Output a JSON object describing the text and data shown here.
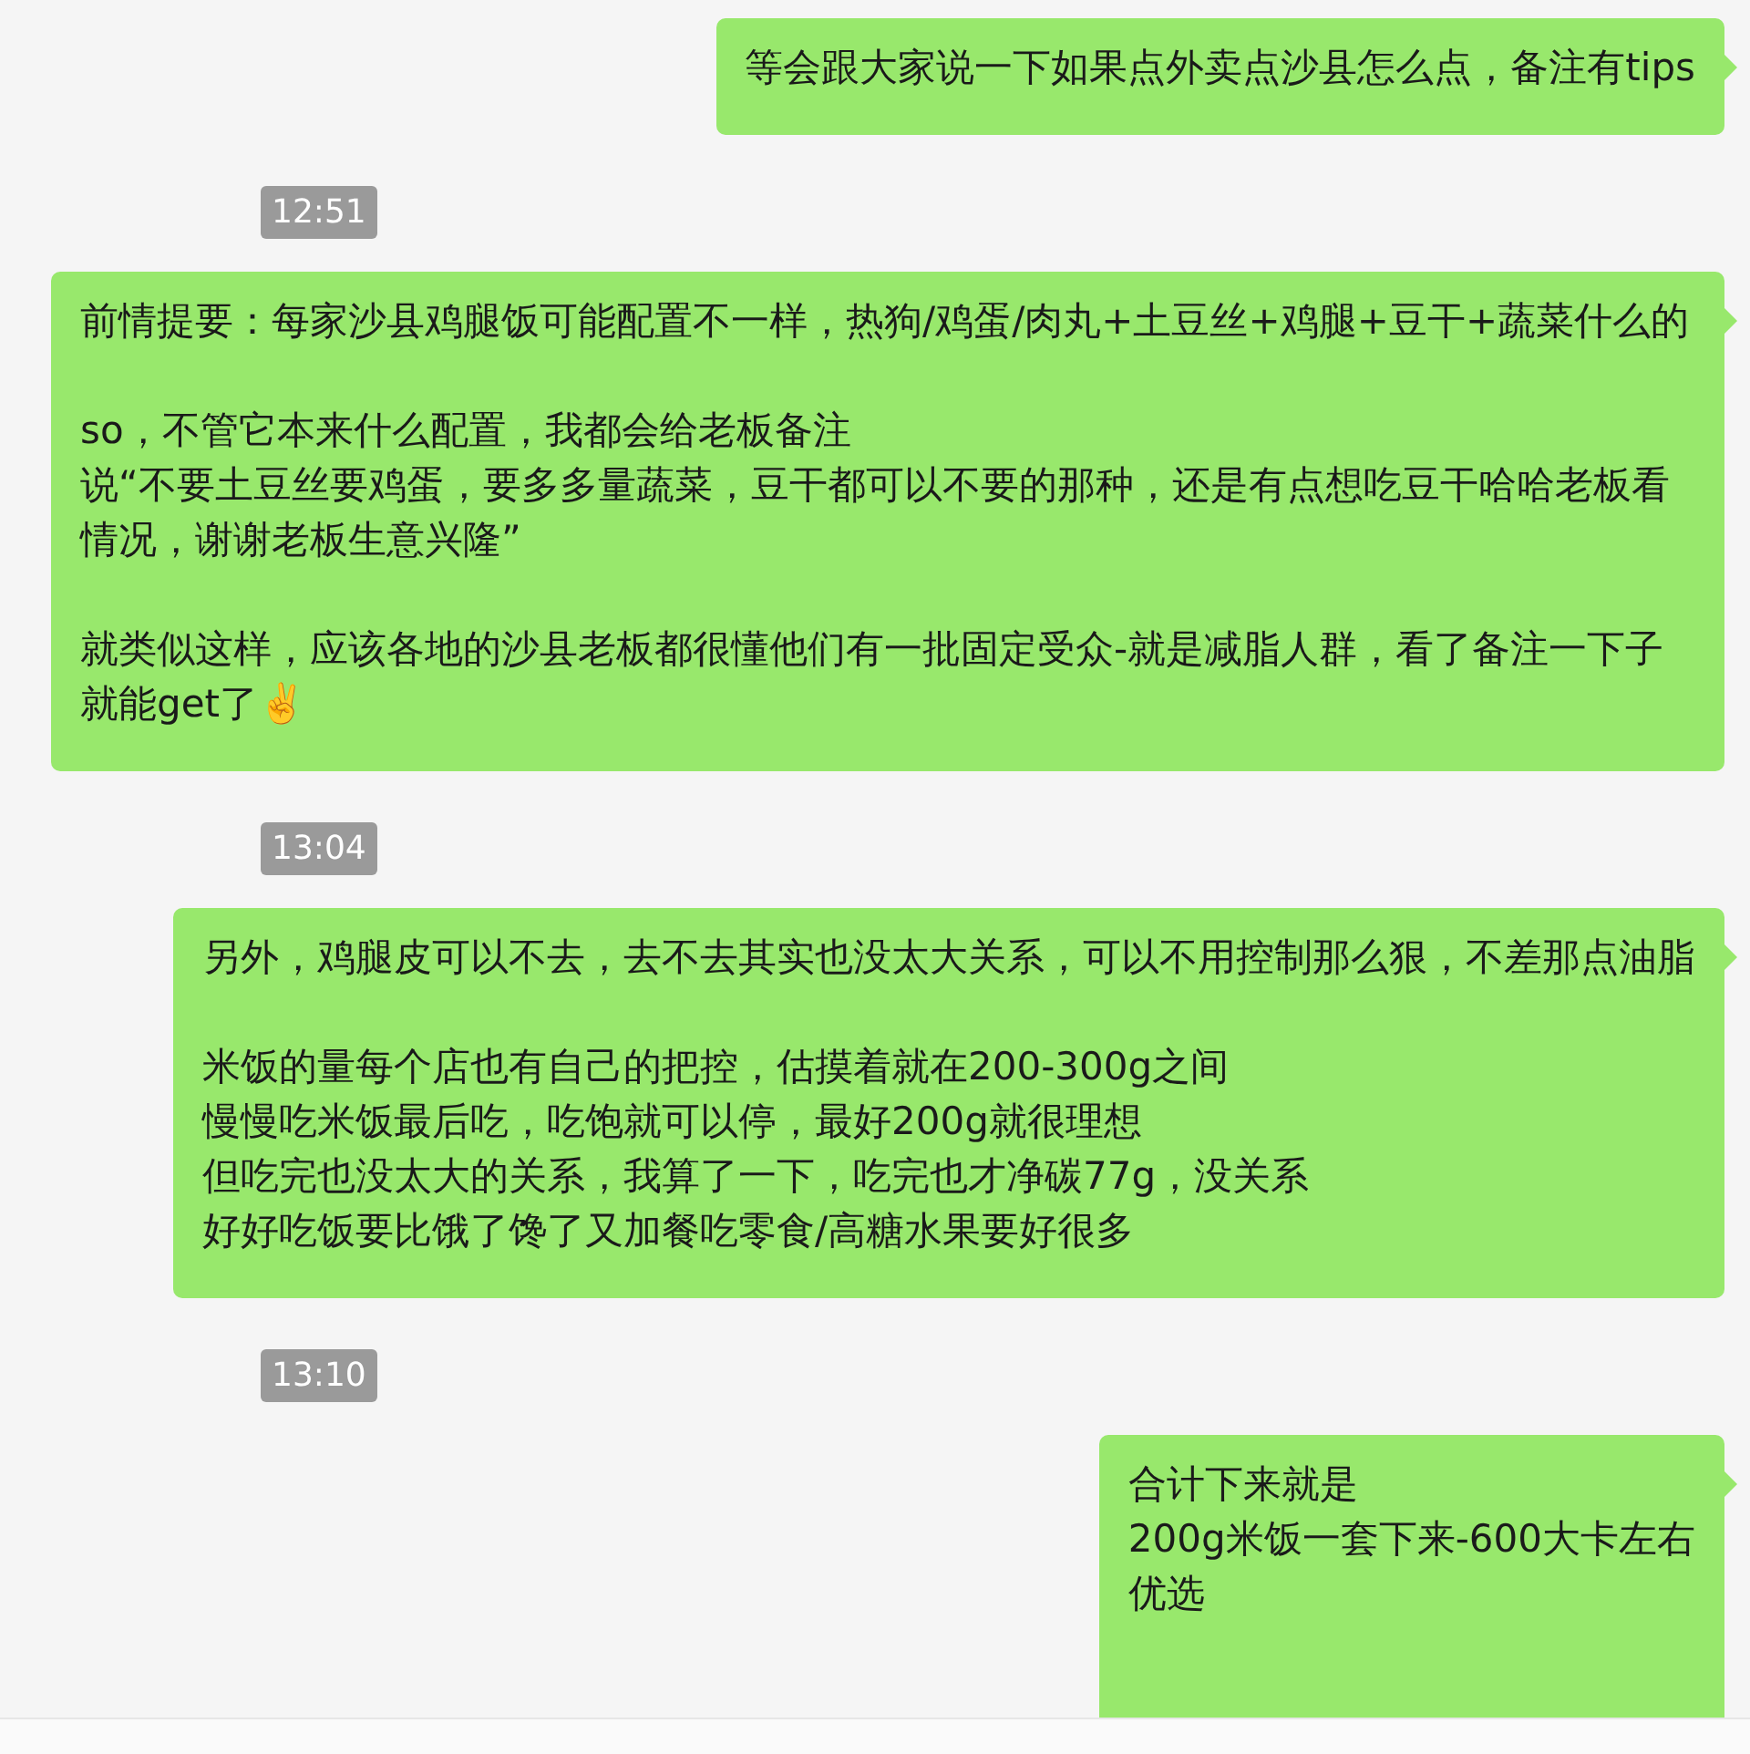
{
  "chat": [
    {
      "kind": "message",
      "paragraphs": [
        [
          "等会跟大家说一下如果点外卖点沙县怎么点，备注有tips"
        ]
      ]
    },
    {
      "kind": "time",
      "text": "12:51"
    },
    {
      "kind": "message",
      "paragraphs": [
        [
          "前情提要：每家沙县鸡腿饭可能配置不一样，热狗/鸡蛋/肉丸+土豆丝+鸡腿+豆干+蔬菜什么的"
        ],
        [
          "so，不管它本来什么配置，我都会给老板备注",
          "说“不要土豆丝要鸡蛋，要多多量蔬菜，豆干都可以不要的那种，还是有点想吃豆干哈哈老板看情况，谢谢老板生意兴隆”"
        ],
        [
          "就类似这样，应该各地的沙县老板都很懂他们有一批固定受众-就是减脂人群，看了备注一下子就能get了✌️"
        ]
      ]
    },
    {
      "kind": "time",
      "text": "13:04"
    },
    {
      "kind": "message",
      "paragraphs": [
        [
          "另外，鸡腿皮可以不去，去不去其实也没太大关系，可以不用控制那么狠，不差那点油脂"
        ],
        [
          "米饭的量每个店也有自己的把控，估摸着就在200-300g之间",
          "慢慢吃米饭最后吃，吃饱就可以停，最好200g就很理想",
          "但吃完也没太大的关系，我算了一下，吃完也才净碳77g，没关系",
          "好好吃饭要比饿了馋了又加餐吃零食/高糖水果要好很多"
        ]
      ]
    },
    {
      "kind": "time",
      "text": "13:10"
    },
    {
      "kind": "message",
      "paragraphs": [
        [
          "合计下来就是",
          "200g米饭一套下来-600大卡左右",
          "优选"
        ]
      ]
    }
  ]
}
